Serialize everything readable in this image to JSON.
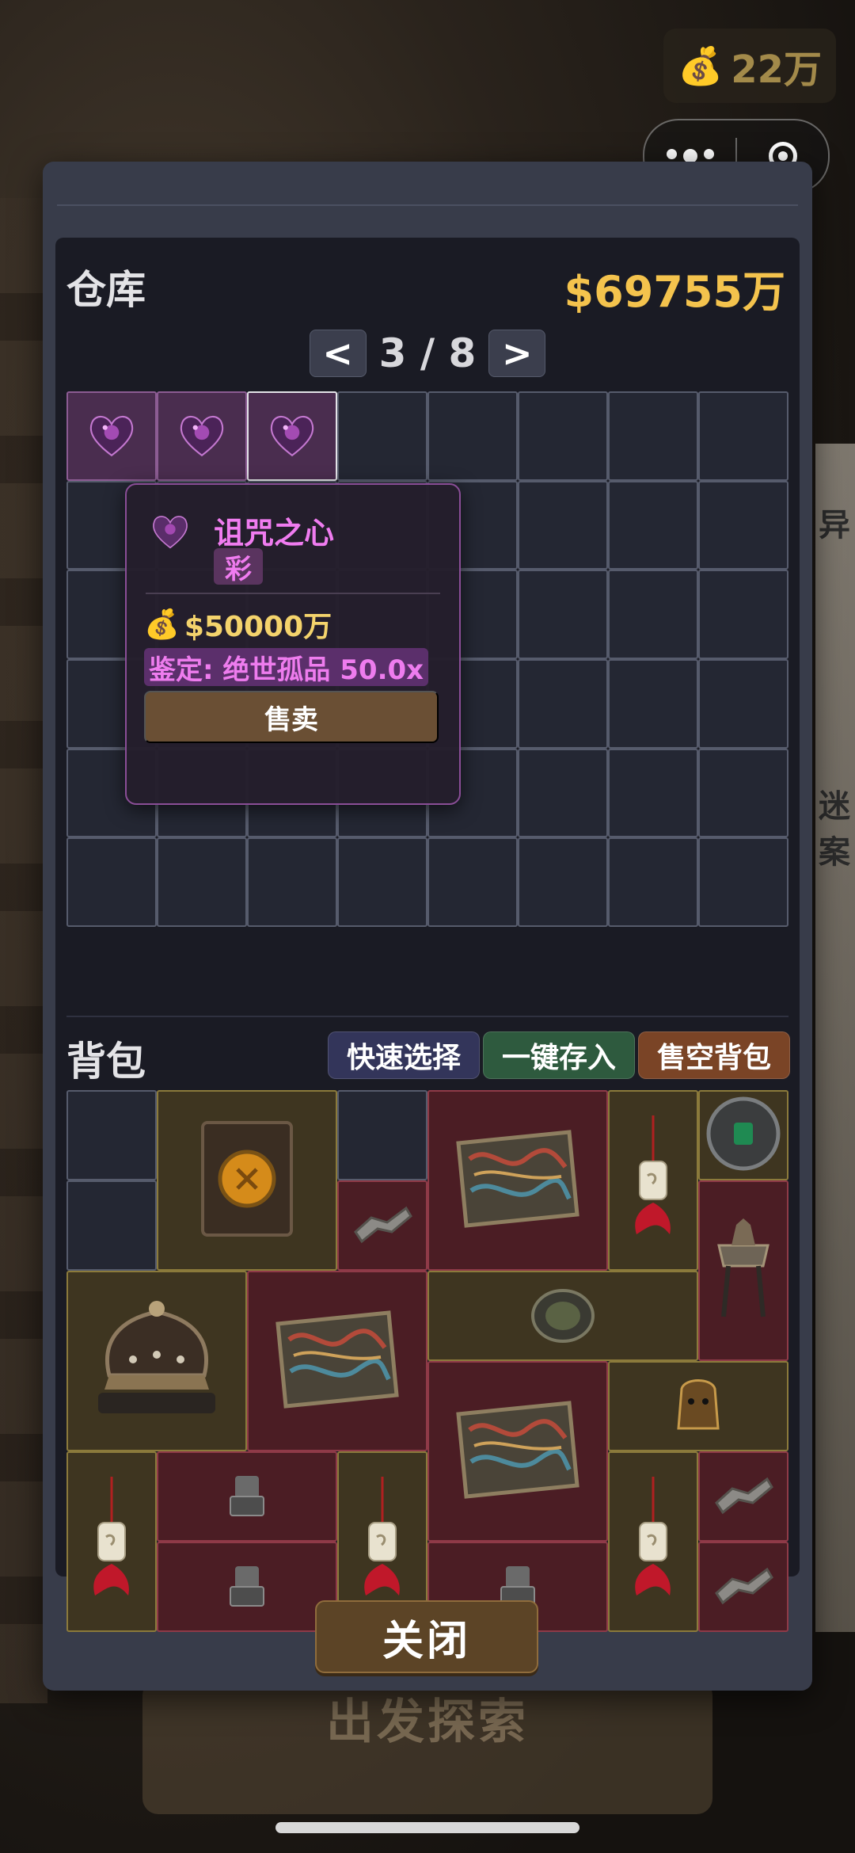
{
  "hud": {
    "coin_icon": "money-bag-icon",
    "coins": "22万"
  },
  "capsule": {
    "menu_icon": "more-dots-icon",
    "close_icon": "target-close-icon"
  },
  "background": {
    "start_button": "出发探索",
    "wall_text_1": "异",
    "wall_text_2": "迷案"
  },
  "warehouse": {
    "title": "仓库",
    "money": "$69755万",
    "pager": {
      "prev": "<",
      "page": "3 / 8",
      "next": ">"
    },
    "items": [
      {
        "name": "curse-heart",
        "slot": 0
      },
      {
        "name": "curse-heart",
        "slot": 1
      },
      {
        "name": "curse-heart",
        "slot": 2,
        "selected": true
      }
    ]
  },
  "tooltip": {
    "name": "诅咒之心",
    "rarity": "彩",
    "price_icon": "money-bag-icon",
    "price": "$50000万",
    "appraisal": "鉴定: 绝世孤品 50.0x",
    "sell_label": "售卖"
  },
  "bag": {
    "title": "背包",
    "quick_select": "快速选择",
    "deposit_all": "一键存入",
    "sell_all": "售空背包",
    "colors": {
      "quick": "#33355a",
      "deposit": "#2e5a3e",
      "sell": "#7a4426",
      "gold": "#8b7a3b",
      "red": "#8f3a48"
    }
  },
  "footer": {
    "close_label": "关闭"
  }
}
